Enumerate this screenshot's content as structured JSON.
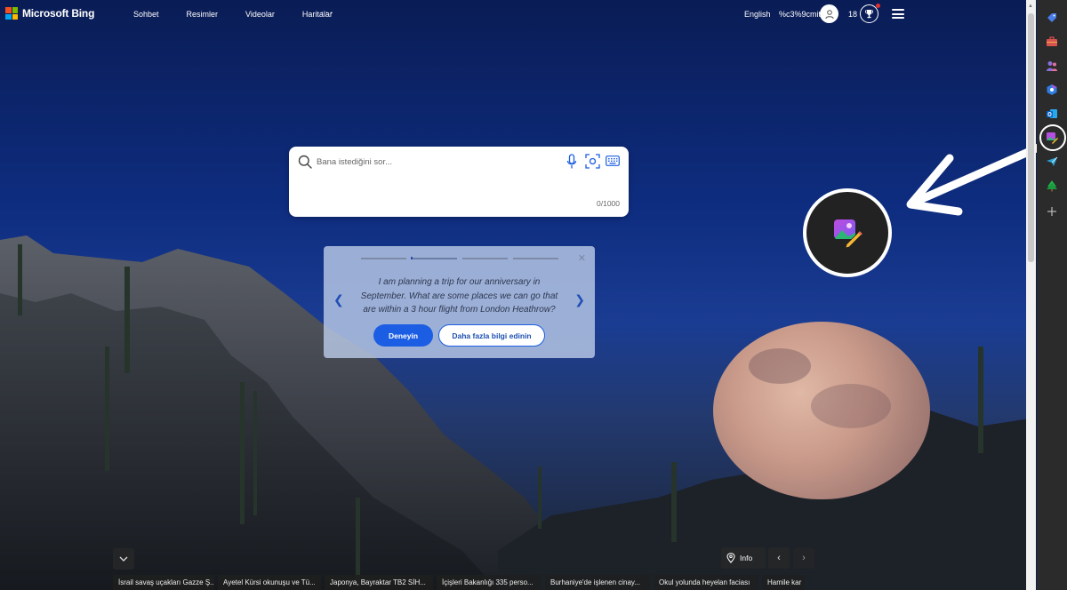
{
  "header": {
    "brand": "Microsoft Bing",
    "nav": [
      "Sohbet",
      "Resimler",
      "Videolar",
      "Haritalar"
    ],
    "more_label": "···",
    "language": "English",
    "username": "%c3%9cmit",
    "points": "18"
  },
  "search": {
    "placeholder": "Bana istediğini sor...",
    "counter": "0/1000"
  },
  "suggestion": {
    "text": "I am planning a trip for our anniversary in September. What are some places we can go that are within a 3 hour flight from London Heathrow?",
    "try_label": "Deneyin",
    "learn_label": "Daha fazla bilgi edinin"
  },
  "bottom": {
    "info_label": "Info",
    "news": [
      "İsrail savaş uçakları Gazze Ş...",
      "Ayetel Kürsi okunuşu ve Tü...",
      "Japonya, Bayraktar TB2 SİH...",
      "İçişleri Bakanlığı 335 perso...",
      "Burhaniye'de işlenen cinay...",
      "Okul yolunda heyelan faciası",
      "Hamile kar"
    ]
  },
  "colors": {
    "accent": "#1c5ee3",
    "sidebar_bg": "#2b2b2b",
    "notification": "#e03131"
  },
  "icons": {
    "sidebar": [
      "tag-icon",
      "toolbox-icon",
      "people-icon",
      "copilot-icon",
      "outlook-icon",
      "image-creator-icon",
      "send-icon",
      "tree-icon",
      "add-icon"
    ]
  }
}
